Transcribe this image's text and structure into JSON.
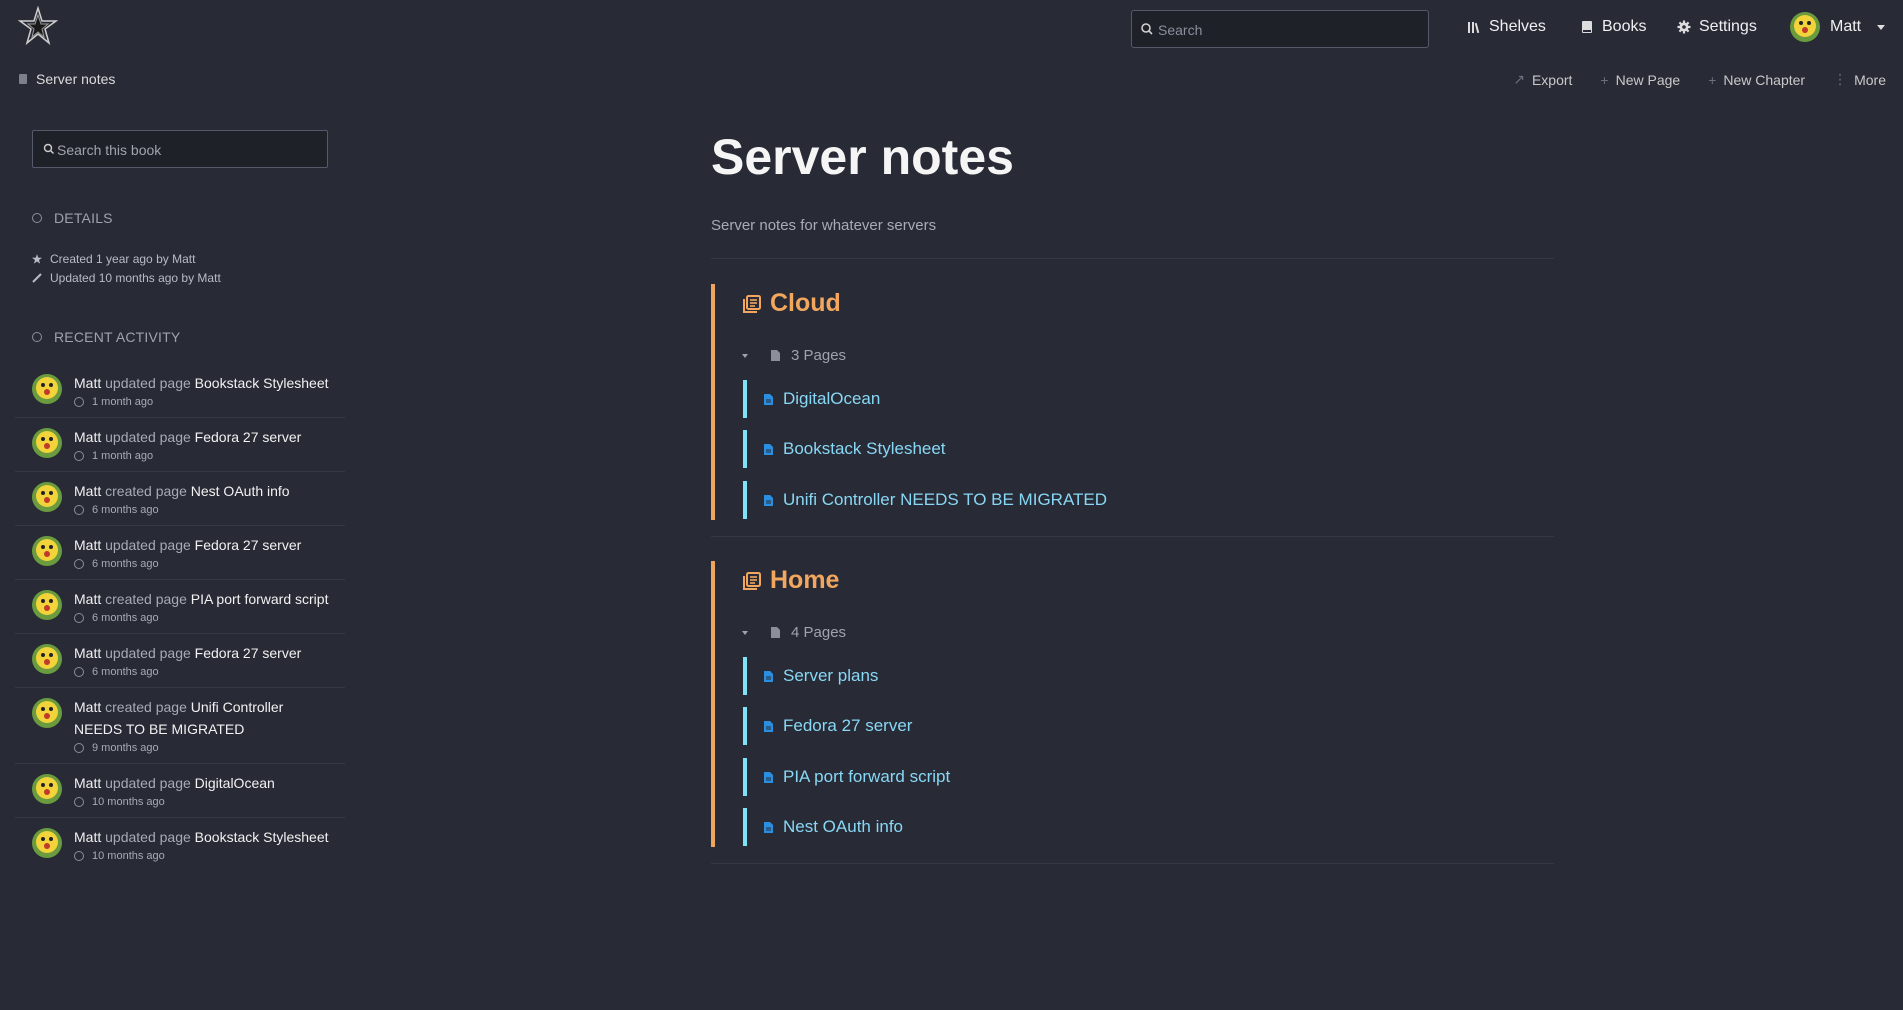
{
  "header": {
    "search_placeholder": "Search",
    "nav": {
      "shelves": "Shelves",
      "books": "Books",
      "settings": "Settings"
    },
    "user_name": "Matt"
  },
  "breadcrumb": {
    "label": "Server notes"
  },
  "actions": {
    "export": "Export",
    "new_page": "New Page",
    "new_chapter": "New Chapter",
    "more": "More"
  },
  "sidebar": {
    "search_placeholder": "Search this book",
    "details_title": "DETAILS",
    "created": "Created 1 year ago by Matt",
    "updated": "Updated 10 months ago by Matt",
    "recent_title": "RECENT ACTIVITY",
    "activity": [
      {
        "user": "Matt",
        "action": "updated page",
        "target": "Bookstack Stylesheet",
        "time": "1 month ago"
      },
      {
        "user": "Matt",
        "action": "updated page",
        "target": "Fedora 27 server",
        "time": "1 month ago"
      },
      {
        "user": "Matt",
        "action": "created page",
        "target": "Nest OAuth info",
        "time": "6 months ago"
      },
      {
        "user": "Matt",
        "action": "updated page",
        "target": "Fedora 27 server",
        "time": "6 months ago"
      },
      {
        "user": "Matt",
        "action": "created page",
        "target": "PIA port forward script",
        "time": "6 months ago"
      },
      {
        "user": "Matt",
        "action": "updated page",
        "target": "Fedora 27 server",
        "time": "6 months ago"
      },
      {
        "user": "Matt",
        "action": "created page",
        "target": "Unifi Controller NEEDS TO BE MIGRATED",
        "time": "9 months ago"
      },
      {
        "user": "Matt",
        "action": "updated page",
        "target": "DigitalOcean",
        "time": "10 months ago"
      },
      {
        "user": "Matt",
        "action": "updated page",
        "target": "Bookstack Stylesheet",
        "time": "10 months ago"
      }
    ]
  },
  "book": {
    "title": "Server notes",
    "description": "Server notes for whatever servers"
  },
  "chapters": [
    {
      "title": "Cloud",
      "page_count": "3 Pages",
      "pages": [
        "DigitalOcean",
        "Bookstack Stylesheet",
        "Unifi Controller NEEDS TO BE MIGRATED"
      ]
    },
    {
      "title": "Home",
      "page_count": "4 Pages",
      "pages": [
        "Server plans",
        "Fedora 27 server",
        "PIA port forward script",
        "Nest OAuth info"
      ]
    }
  ],
  "colors": {
    "background": "#282a36",
    "chapter_accent": "#f0a55e",
    "page_accent": "#7fe3f7",
    "page_link": "#88d8f5"
  }
}
